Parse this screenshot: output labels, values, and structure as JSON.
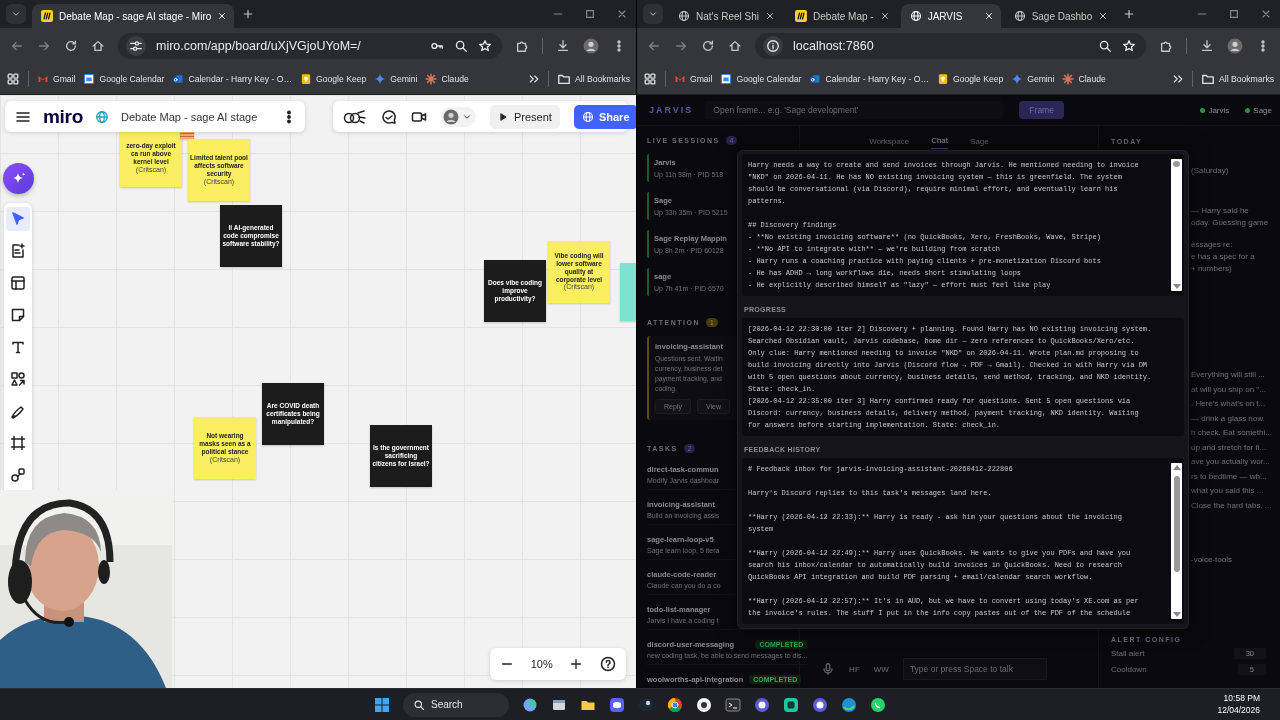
{
  "browsers": [
    {
      "tabs": [
        {
          "label": "Debate Map - sage AI stage - Miro",
          "selected": true
        }
      ],
      "address": {
        "url": "miro.com/app/board/uXjVGjoUYoM=/"
      },
      "bookmarks": [
        {
          "label": "Gmail"
        },
        {
          "label": "Google Calendar"
        },
        {
          "label": "Calendar - Harry Key - O…"
        },
        {
          "label": "Google Keep"
        },
        {
          "label": "Gemini"
        },
        {
          "label": "Claude"
        }
      ],
      "all_bookmarks": "All Bookmarks",
      "page": {
        "kind": "miro",
        "logo": "miro",
        "board_title": "Debate Map - sage AI stage",
        "present": "Present",
        "share": "Share",
        "tools": [
          {
            "kind": "select",
            "selected": true
          },
          {
            "kind": "create",
            "selected": false
          },
          {
            "kind": "templates",
            "selected": false
          },
          {
            "kind": "sticky",
            "selected": false
          },
          {
            "kind": "text",
            "selected": false
          },
          {
            "kind": "shapes",
            "selected": false
          },
          {
            "kind": "pen",
            "selected": false
          },
          {
            "kind": "frame",
            "selected": false
          },
          {
            "kind": "diagram",
            "selected": false
          }
        ],
        "zoom": "10%",
        "notes": [
          {
            "kind": "sticky",
            "color": "#f9ee5f",
            "text": "zero-day exploit ca run above kernel level",
            "source": "(Critscan)"
          },
          {
            "kind": "mini",
            "color": "#f6ad74"
          },
          {
            "kind": "sticky",
            "color": "#f9ee5f",
            "text": "Limited talent pool affects software security",
            "source": "(Critscan)"
          },
          {
            "kind": "sticky",
            "color": "#1c1c1c",
            "text": "ll AI-generated code compromise software stability?"
          },
          {
            "kind": "sticky",
            "color": "#1c1c1c",
            "text": "Does vibe coding improve productivity?"
          },
          {
            "kind": "sticky",
            "color": "#f9ee5f",
            "text": "Vibe coding will lower software quality at corporate level",
            "source": "(Critscan)"
          },
          {
            "kind": "sticky",
            "color": "#7de3cf"
          },
          {
            "kind": "sticky",
            "color": "#1c1c1c",
            "text": "Are COVID death certificates being manipulated?"
          },
          {
            "kind": "sticky",
            "color": "#f9ee5f",
            "text": "Not wearing masks seen as a political stance",
            "source": "(Critscan)"
          },
          {
            "kind": "sticky",
            "color": "#1c1c1c",
            "text": "Is the government sacrificing citizens for Israel?"
          }
        ]
      }
    },
    {
      "tabs": [
        {
          "label": "Nat's Reel Shi",
          "selected": false
        },
        {
          "label": "Debate Map -",
          "selected": false
        },
        {
          "label": "JARVIS",
          "selected": true
        },
        {
          "label": "Sage Dashbo",
          "selected": false
        }
      ],
      "address": {
        "url": "localhost:7860"
      },
      "bookmarks": [
        {
          "label": "Gmail"
        },
        {
          "label": "Google Calendar"
        },
        {
          "label": "Calendar - Harry Key - O…"
        },
        {
          "label": "Google Keep"
        },
        {
          "label": "Gemini"
        },
        {
          "label": "Claude"
        }
      ],
      "all_bookmarks": "All Bookmarks",
      "page": {
        "kind": "jarvis",
        "logo": "JARVIS",
        "frame_placeholder": "Open frame... e.g. 'Sage development'",
        "frame_button": "Frame",
        "status": [
          {
            "label": "Jarvis",
            "color": "#2f8f46"
          },
          {
            "label": "Sage",
            "color": "#2f8f46"
          }
        ],
        "live_sessions": {
          "title": "LIVE SESSIONS",
          "count": "4",
          "items": [
            {
              "title": "Jarvis",
              "meta": "Up 11h 38m · PID 518"
            },
            {
              "title": "Sage",
              "meta": "Up 33h 35m · PID 5215"
            },
            {
              "title": "Sage Replay Mappin",
              "meta": "Up 8h 2m · PID 60128"
            },
            {
              "title": "sage",
              "meta": "Up 7h 41m · PID 6570"
            }
          ]
        },
        "attention": {
          "title": "ATTENTION",
          "count": "1",
          "items": [
            {
              "title": "invoicing-assistant",
              "lines": [
                "Questions sent. Waitin",
                "currency, business det",
                "payment tracking, and",
                "coding."
              ],
              "actions": [
                "Reply",
                "View"
              ]
            }
          ]
        },
        "tasks": {
          "title": "TASKS",
          "count": "2",
          "items": [
            {
              "title": "direct-task-commun",
              "description": "Modify Jarvis dashboar"
            },
            {
              "title": "invoicing-assistant",
              "description": "Build an invoicing assis"
            },
            {
              "title": "sage-learn-loop-v5",
              "description": "Sage learn loop, 5 itera"
            },
            {
              "title": "claude-code-reader",
              "description": "Claude can you do a co"
            },
            {
              "title": "todo-list-manager",
              "description": "Jarvis I have a coding t"
            },
            {
              "title": "discord-user-messaging",
              "description": "new coding task, be able to send messages to dis...",
              "status": "COMPLETED"
            },
            {
              "title": "woolworths-api-integration",
              "status": "COMPLETED"
            }
          ]
        },
        "tabs": [
          {
            "label": "Workspace",
            "selected": false
          },
          {
            "label": "Chat",
            "selected": true
          },
          {
            "label": "Sage",
            "selected": false
          }
        ],
        "composer": {
          "buttons": [
            "HF",
            "WW"
          ],
          "placeholder": "Type or press Space to talk"
        },
        "today": {
          "title": "TODAY",
          "notes": [
            [
              "(Saturday)"
            ],
            [
              "— Harry said he",
              "oday. Guessing game"
            ],
            [
              "essages re:",
              "e has a spec for a",
              "+ numbers)"
            ]
          ],
          "reminders": [
            "Everything will still ...",
            "at will you ship on \"...",
            ". Here's what's on t...",
            "— drink a glass now.",
            "h check. Eat somethi...",
            "up and stretch for fi...",
            "ave you actually wor...",
            "rs to bedtime — wh...",
            "what you said this ...",
            "Close the hard tabs. ..."
          ],
          "tag": "-voice-tools"
        },
        "alert_config": {
          "title": "ALERT CONFIG",
          "rows": [
            {
              "label": "Stall alert",
              "value": "30"
            },
            {
              "label": "Cooldown",
              "value": "5"
            }
          ]
        },
        "modal": {
          "brief": [
            [
              "Harry needs a way to create and send invoices through Jarvis. He mentioned needing to invoice",
              "\"NKD\" on 2026-04-11. He has NO existing invoicing system — this is greenfield. The system",
              "should be conversational (via Discord), require minimal effort, and eventually learn his",
              "patterns."
            ],
            [
              "## Discovery findings",
              "- **No existing invoicing software** (no QuickBooks, Xero, FreshBooks, Wave, Stripe)",
              "- **No API to integrate with** — we're building from scratch",
              "- Harry runs a coaching practice with paying clients + pre-monetization Discord bots",
              "- He has ADHD → long workflows die, needs short stimulating loops",
              "- He explicitly described himself as \"lazy\" — effort must feel like play"
            ]
          ],
          "progress_title": "PROGRESS",
          "progress": [
            [
              "[2026-04-12 22:30:00 iter 2] Discovery + planning. Found Harry has NO existing invoicing system.",
              "Searched Obsidian vault, Jarvis codebase, home dir — zero references to QuickBooks/Xero/etc.",
              "Only clue: Harry mentioned needing to invoice \"NKD\" on 2026-04-11. Wrote plan.md proposing to",
              "build invoicing directly into Jarvis (Discord flow → PDF → Gmail). Checked in with Harry via DM",
              "with 5 open questions about currency, business details, send method, tracking, and NKD identity.",
              "State: check_in."
            ],
            [
              "[2026-04-12 22:35:00 iter 3] Harry confirmed ready for questions. Sent 5 open questions via",
              "Discord: currency, business details, delivery method, payment tracking, NKD identity. Waiting",
              "for answers before starting implementation. State: check_in."
            ]
          ],
          "feedback_title": "FEEDBACK HISTORY",
          "feedback": [
            [
              "# Feedback inbox for jarvis-invoicing-assistant-20260412-222806"
            ],
            [
              "Harry's Discord replies to this task's messages land here."
            ],
            [
              "**Harry (2026-04-12 22:33):** Harry is ready - ask him your questions about the invoicing",
              "system"
            ],
            [
              "**Harry (2026-04-12 22:49):** Harry uses QuickBooks. He wants to give you PDFs and have you",
              "search his inbox/calendar to automatically build invoices in QuickBooks. Need to research",
              "QuickBooks API integration and build PDF parsing + email/calendar search workflow."
            ],
            [
              "**Harry (2026-04-12 22:57):** It's in AUD, but we have to convert using today's XE.com as per",
              "the invoice's rules. The stuff I put in the info copy pastes out of the PDF of the schedule"
            ]
          ]
        }
      }
    }
  ],
  "taskbar": {
    "search": "Search",
    "apps": [
      {
        "kind": "copilot"
      },
      {
        "kind": "window"
      },
      {
        "kind": "folder"
      },
      {
        "kind": "discord"
      },
      {
        "kind": "steam"
      },
      {
        "kind": "chrome"
      },
      {
        "kind": "circle"
      },
      {
        "kind": "terminal"
      },
      {
        "kind": "purple"
      },
      {
        "kind": "green"
      },
      {
        "kind": "purple"
      },
      {
        "kind": "edge"
      },
      {
        "kind": "chat"
      }
    ],
    "time": "10:58 PM",
    "date": "12/04/2026"
  }
}
